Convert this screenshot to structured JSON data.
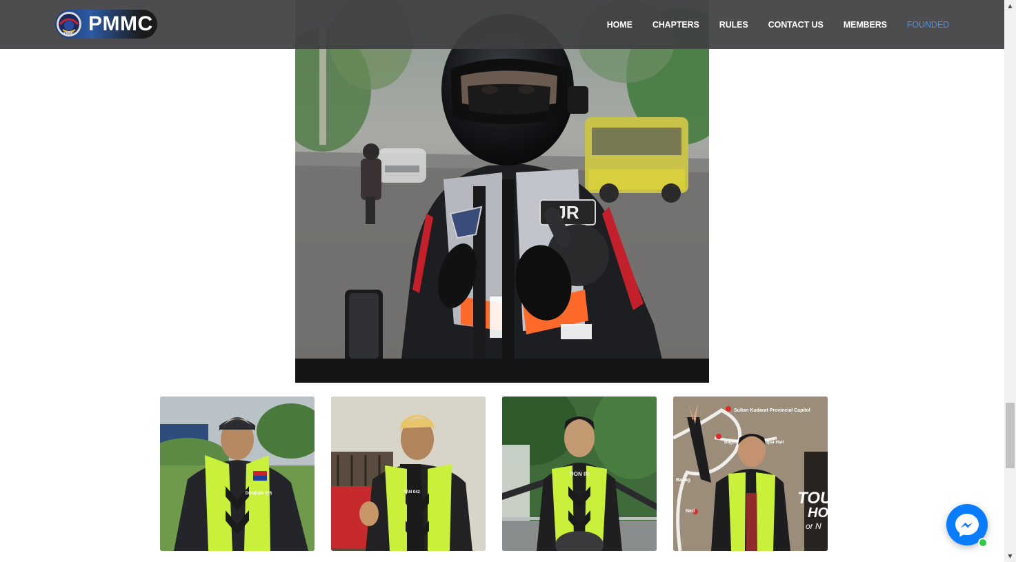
{
  "site": {
    "brand_name": "PMMC",
    "logo_icon": "pmmc-emblem-logo",
    "accent_color": "#5b8fd6",
    "header_color": "#404042"
  },
  "nav": {
    "items": [
      {
        "label": "HOME",
        "active": false
      },
      {
        "label": "CHAPTERS",
        "active": false
      },
      {
        "label": "RULES",
        "active": false
      },
      {
        "label": "CONTACT US",
        "active": false
      },
      {
        "label": "MEMBERS",
        "active": false
      },
      {
        "label": "FOUNDED",
        "active": true
      }
    ]
  },
  "gallery": {
    "hero": {
      "icon": "rider-photo",
      "vest_patch_text": "JR"
    },
    "thumbnails": [
      {
        "icon": "rider-photo",
        "vest_color": "#c9f03a",
        "vest_text": "DONDON 035"
      },
      {
        "icon": "rider-photo",
        "vest_color": "#c9f03a",
        "vest_text": "YAN 042"
      },
      {
        "icon": "rider-photo",
        "vest_color": "#c9f03a",
        "vest_text": "DON IN"
      },
      {
        "icon": "rider-photo",
        "vest_color": "#c9f03a",
        "map_labels": [
          "Sultan Kudarat Provincial Capitol",
          "Bagumbayan Municipal Hall",
          "Basag",
          "Ned"
        ],
        "poster_text": [
          "TOU",
          "HO",
          "or N"
        ]
      }
    ]
  },
  "widgets": {
    "messenger_icon": "messenger-icon",
    "messenger_color": "#0a7cff",
    "online_color": "#31cc46"
  },
  "scrollbar": {
    "up_glyph": "▲",
    "down_glyph": "▼"
  }
}
